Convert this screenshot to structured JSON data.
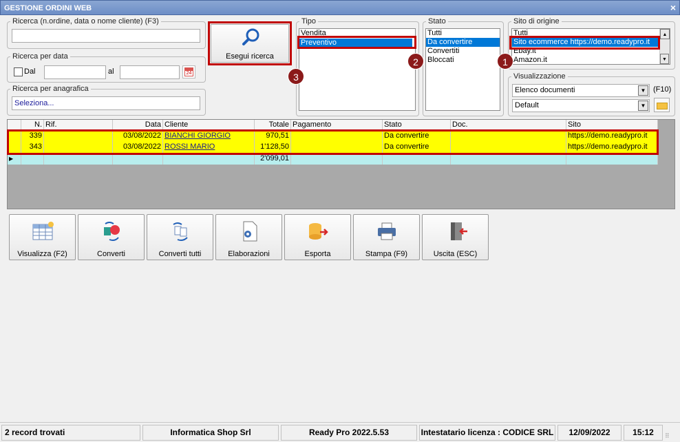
{
  "window": {
    "title": "GESTIONE ORDINI WEB",
    "close_label": "×"
  },
  "search": {
    "label": "Ricerca (n.ordine, data o nome cliente) (F3)",
    "value": "",
    "date_label": "Ricerca per data",
    "from_label": "Dal",
    "to_label": "al",
    "from_value": "",
    "to_value": "",
    "calendar_day": "24",
    "anag_label": "Ricerca per anagrafica",
    "anag_value": "Seleziona..."
  },
  "search_button": {
    "label": "Esegui ricerca"
  },
  "tipo": {
    "label": "Tipo",
    "items": [
      "Vendita",
      "Preventivo"
    ],
    "selected": 1
  },
  "stato": {
    "label": "Stato",
    "items": [
      "Tutti",
      "Da convertire",
      "Convertiti",
      "Bloccati"
    ],
    "selected": 1
  },
  "sito": {
    "label": "Sito di origine",
    "items": [
      "Tutti",
      "Sito ecommerce https://demo.readypro.it",
      "Ebay.it",
      "Amazon.it"
    ],
    "selected": 1
  },
  "visualizzazione": {
    "label": "Visualizzazione",
    "combo1": "Elenco documenti",
    "shortcut": "(F10)",
    "combo2": "Default"
  },
  "badges": [
    "1",
    "2",
    "3"
  ],
  "table": {
    "headers": [
      "N.",
      "Rif.",
      "Data",
      "Cliente",
      "Totale",
      "Pagamento",
      "Stato",
      "Doc.",
      "Sito"
    ],
    "rows": [
      [
        "339",
        "",
        "03/08/2022",
        "BIANCHI GIORGIO",
        "970,51",
        "",
        "Da convertire",
        "",
        "https://demo.readypro.it"
      ],
      [
        "343",
        "",
        "03/08/2022",
        "ROSSI MARIO",
        "1'128,50",
        "",
        "Da convertire",
        "",
        "https://demo.readypro.it"
      ]
    ],
    "total": "2'099,01",
    "row_color": "#ffff00",
    "total_color": "#b8eeee"
  },
  "toolbar": [
    {
      "label": "Visualizza (F2)",
      "icon": "grid-view-icon"
    },
    {
      "label": "Converti",
      "icon": "convert-icon"
    },
    {
      "label": "Converti tutti",
      "icon": "convert-all-icon"
    },
    {
      "label": "Elaborazioni",
      "icon": "process-document-icon"
    },
    {
      "label": "Esporta",
      "icon": "export-database-icon"
    },
    {
      "label": "Stampa (F9)",
      "icon": "printer-icon"
    },
    {
      "label": "Uscita (ESC)",
      "icon": "exit-door-icon"
    }
  ],
  "status": {
    "records": "2 record trovati",
    "company": "Informatica Shop Srl",
    "version": "Ready Pro 2022.5.53",
    "license": "Intestatario licenza : CODICE SRL",
    "date": "12/09/2022",
    "time": "15:12"
  }
}
